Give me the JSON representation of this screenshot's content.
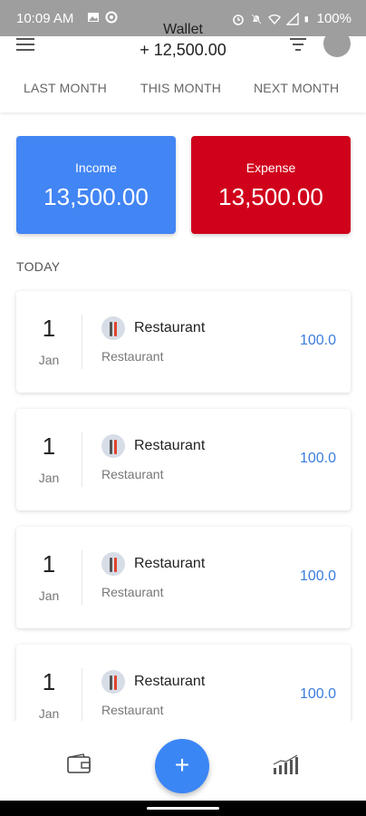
{
  "status_bar": {
    "time": "10:09 AM",
    "battery": "100%"
  },
  "header": {
    "title": "Wallet",
    "balance": "+ 12,500.00"
  },
  "tabs": [
    "LAST MONTH",
    "THIS MONTH",
    "NEXT MONTH"
  ],
  "summary": {
    "income_label": "Income",
    "income_value": "13,500.00",
    "expense_label": "Expense",
    "expense_value": "13,500.00"
  },
  "section_label": "TODAY",
  "transactions": [
    {
      "day": "1",
      "month": "Jan",
      "title": "Restaurant",
      "category": "Restaurant",
      "amount": "100.0"
    },
    {
      "day": "1",
      "month": "Jan",
      "title": "Restaurant",
      "category": "Restaurant",
      "amount": "100.0"
    },
    {
      "day": "1",
      "month": "Jan",
      "title": "Restaurant",
      "category": "Restaurant",
      "amount": "100.0"
    },
    {
      "day": "1",
      "month": "Jan",
      "title": "Restaurant",
      "category": "Restaurant",
      "amount": "100.0"
    }
  ],
  "bottom_nav": {
    "fab_symbol": "+",
    "icons": [
      "wallet-icon",
      "add-icon",
      "chart-icon"
    ]
  },
  "colors": {
    "income": "#4285f4",
    "expense": "#d0021b",
    "amount": "#3b7ddd",
    "fab": "#3b86f5"
  }
}
